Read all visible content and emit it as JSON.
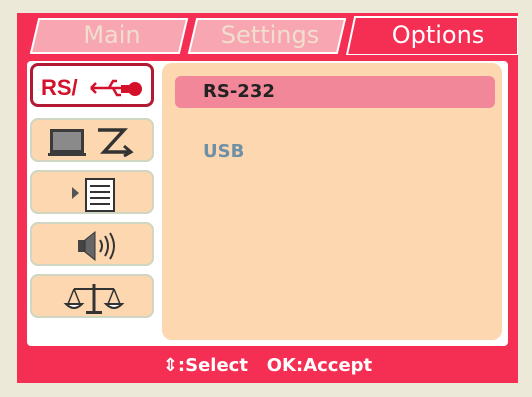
{
  "tabs": [
    {
      "label": "Main",
      "active": false
    },
    {
      "label": "Settings",
      "active": false
    },
    {
      "label": "Options",
      "active": true
    }
  ],
  "sidebar": {
    "items": [
      {
        "icon": "rs232-usb-icon",
        "text": "RS/",
        "selected": true
      },
      {
        "icon": "monitor-arrow-icon",
        "selected": false
      },
      {
        "icon": "list-pointer-icon",
        "selected": false
      },
      {
        "icon": "speaker-icon",
        "selected": false
      },
      {
        "icon": "balance-scale-icon",
        "selected": false
      }
    ]
  },
  "panel": {
    "options": [
      {
        "label": "RS-232",
        "selected": true
      },
      {
        "label": "USB",
        "selected": false
      }
    ]
  },
  "footer": {
    "select_hint": ":Select",
    "accept_hint": "OK:Accept"
  },
  "colors": {
    "frame": "#f52f54",
    "panel": "#fcd7b0",
    "highlight": "#f2879a",
    "inactive_tab": "#f7a0b0"
  }
}
